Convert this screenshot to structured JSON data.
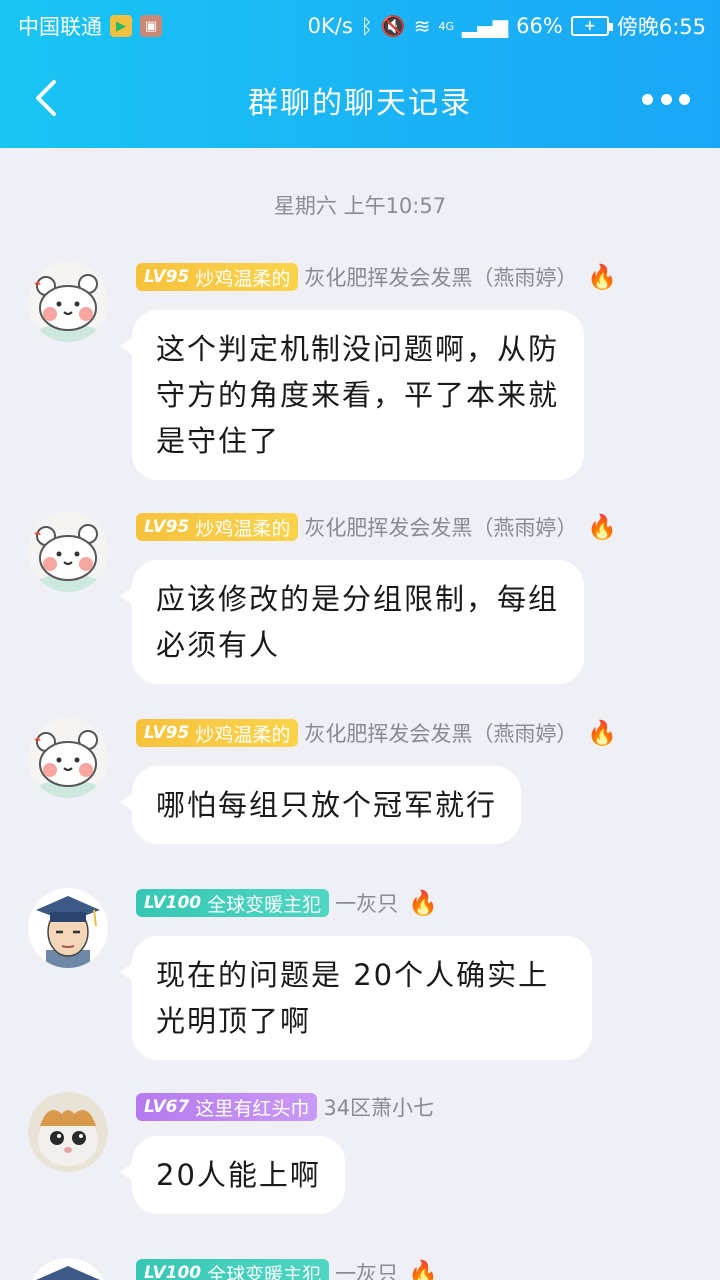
{
  "status_bar": {
    "carrier": "中国联通",
    "net_speed": "0K/s",
    "signal": "4G",
    "battery": "66%",
    "time": "傍晚6:55"
  },
  "nav": {
    "title": "群聊的聊天记录",
    "back_icon": "back-chevron-icon",
    "more_icon": "more-dots-icon"
  },
  "timestamp": "星期六 上午10:57",
  "messages": [
    {
      "level": "LV95",
      "title": "炒鸡温柔的",
      "badge_color": "#f7c23b",
      "name": "灰化肥挥发会发黑（燕雨婷）",
      "text": "这个判定机制没问题啊，从防守方的角度来看，平了本来就是守住了",
      "flame": "🔥"
    },
    {
      "level": "LV95",
      "title": "炒鸡温柔的",
      "badge_color": "#f7c23b",
      "name": "灰化肥挥发会发黑（燕雨婷）",
      "text": "应该修改的是分组限制，每组必须有人",
      "flame": "🔥"
    },
    {
      "level": "LV95",
      "title": "炒鸡温柔的",
      "badge_color": "#f7c23b",
      "name": "灰化肥挥发会发黑（燕雨婷）",
      "text": "哪怕每组只放个冠军就行",
      "flame": "🔥"
    },
    {
      "level": "LV100",
      "title": "全球变暖主犯",
      "badge_color": "#36c7b4",
      "name": "一灰只",
      "text": "现在的问题是 20个人确实上光明顶了啊",
      "flame": "🔥"
    },
    {
      "level": "LV67",
      "title": "这里有红头巾",
      "badge_color": "#b57aee",
      "name": "34区萧小七",
      "text": "20人能上啊",
      "flame": ""
    },
    {
      "level": "LV100",
      "title": "全球变暖主犯",
      "badge_color": "#36c7b4",
      "name": "一灰只",
      "text": "",
      "flame": "🔥"
    }
  ]
}
